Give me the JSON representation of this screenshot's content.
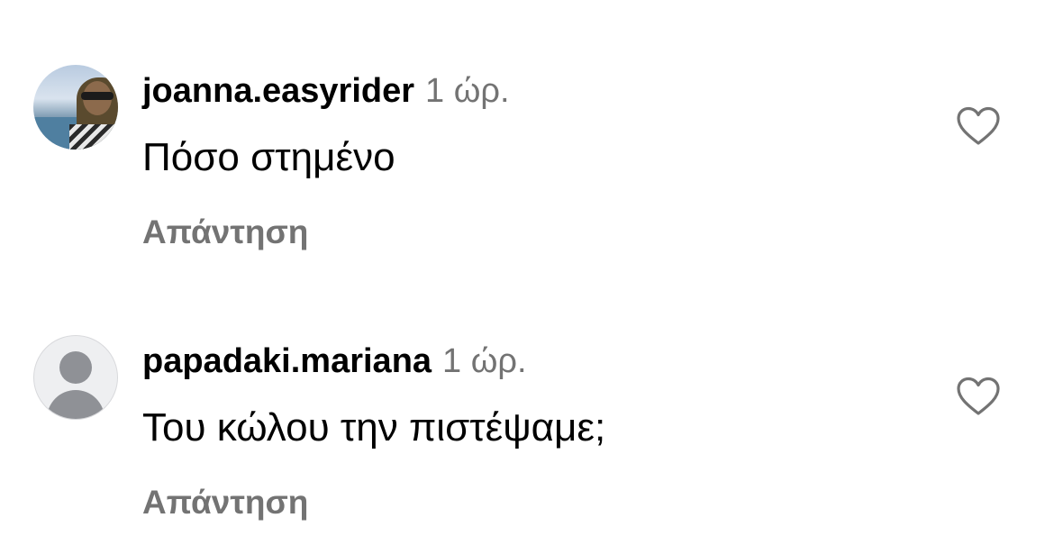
{
  "comments": [
    {
      "username": "joanna.easyrider",
      "time": "1 ώρ.",
      "text": "Πόσο στημένο",
      "reply_label": "Απάντηση",
      "avatar_type": "photo",
      "like_icon": "heart-icon"
    },
    {
      "username": "papadaki.mariana",
      "time": "1 ώρ.",
      "text": "Του κώλου την πιστέψαμε;",
      "reply_label": "Απάντηση",
      "avatar_type": "default",
      "like_icon": "heart-icon"
    }
  ],
  "colors": {
    "secondary_text": "#737373",
    "primary_text": "#000000",
    "background": "#ffffff"
  }
}
